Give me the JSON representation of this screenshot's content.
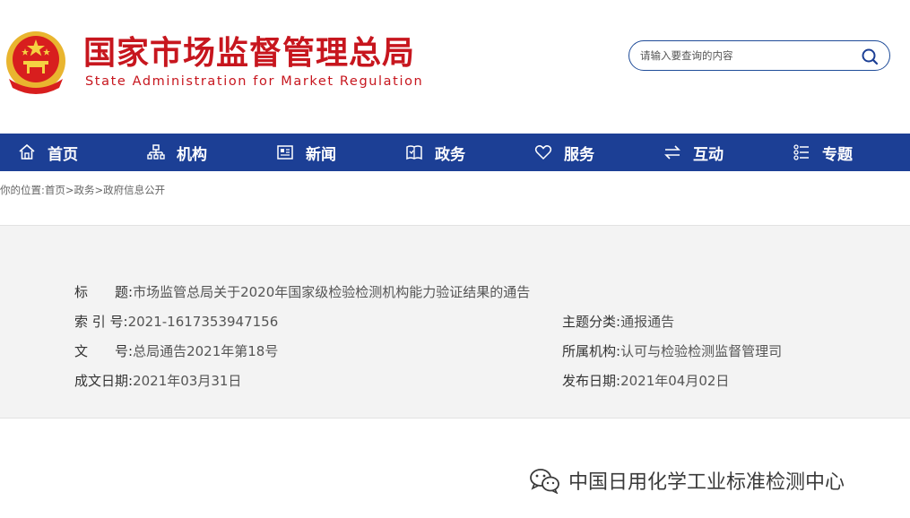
{
  "header": {
    "title": "国家市场监督管理总局",
    "subtitle": "State Administration for Market Regulation",
    "search_placeholder": "请输入要查询的内容",
    "brand_color": "#c7161e",
    "nav_color": "#1c3f95"
  },
  "nav": {
    "items": [
      {
        "label": "首页",
        "icon": "home-icon"
      },
      {
        "label": "机构",
        "icon": "org-chart-icon"
      },
      {
        "label": "新闻",
        "icon": "newspaper-icon"
      },
      {
        "label": "政务",
        "icon": "book-icon"
      },
      {
        "label": "服务",
        "icon": "heart-icon"
      },
      {
        "label": "互动",
        "icon": "exchange-arrows-icon"
      },
      {
        "label": "专题",
        "icon": "list-icon"
      }
    ]
  },
  "breadcrumb": {
    "prefix": "你的位置:",
    "items": [
      "首页",
      "政务",
      "政府信息公开"
    ],
    "separator": ">"
  },
  "info": {
    "title_label": "标　　题:",
    "title_value": "市场监管总局关于2020年国家级检验检测机构能力验证结果的通告",
    "index_label": "索 引 号:",
    "index_value": "2021-1617353947156",
    "topic_label": "主题分类:",
    "topic_value": "通报通告",
    "doc_label": "文　　号:",
    "doc_value": "总局通告2021年第18号",
    "dept_label": "所属机构:",
    "dept_value": "认可与检验检测监督管理司",
    "created_label": "成文日期:",
    "created_value": "2021年03月31日",
    "published_label": "发布日期:",
    "published_value": "2021年04月02日"
  },
  "watermark": {
    "text": "中国日用化学工业标准检测中心",
    "icon": "wechat-icon"
  }
}
